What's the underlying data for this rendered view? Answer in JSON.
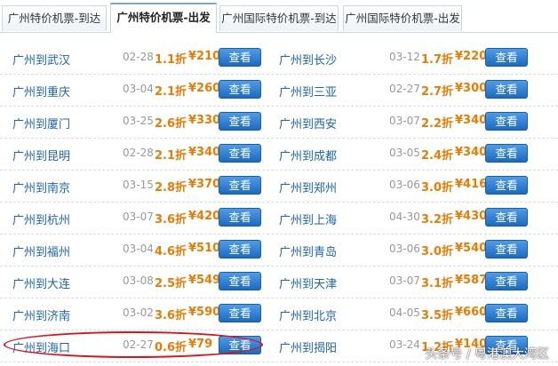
{
  "tabs": [
    {
      "label": "广州特价机票-到达",
      "active": false
    },
    {
      "label": "广州特价机票-出发",
      "active": true
    },
    {
      "label": "广州国际特价机票-到达",
      "active": false
    },
    {
      "label": "广州国际特价机票-出发",
      "active": false
    }
  ],
  "button_label": "查看",
  "rows": [
    {
      "left": {
        "route": "广州到武汉",
        "date": "02-28",
        "discount": "1.1折",
        "price": "¥210"
      },
      "right": {
        "route": "广州到长沙",
        "date": "03-12",
        "discount": "1.7折",
        "price": "¥220"
      }
    },
    {
      "left": {
        "route": "广州到重庆",
        "date": "03-04",
        "discount": "2.1折",
        "price": "¥260"
      },
      "right": {
        "route": "广州到三亚",
        "date": "02-27",
        "discount": "2.7折",
        "price": "¥300"
      }
    },
    {
      "left": {
        "route": "广州到厦门",
        "date": "03-25",
        "discount": "2.6折",
        "price": "¥330"
      },
      "right": {
        "route": "广州到西安",
        "date": "03-07",
        "discount": "2.2折",
        "price": "¥340"
      }
    },
    {
      "left": {
        "route": "广州到昆明",
        "date": "02-28",
        "discount": "2.1折",
        "price": "¥340"
      },
      "right": {
        "route": "广州到成都",
        "date": "03-05",
        "discount": "2.4折",
        "price": "¥340"
      }
    },
    {
      "left": {
        "route": "广州到南京",
        "date": "03-15",
        "discount": "2.8折",
        "price": "¥370"
      },
      "right": {
        "route": "广州到郑州",
        "date": "03-06",
        "discount": "3.0折",
        "price": "¥416"
      }
    },
    {
      "left": {
        "route": "广州到杭州",
        "date": "03-07",
        "discount": "3.6折",
        "price": "¥420"
      },
      "right": {
        "route": "广州到上海",
        "date": "04-30",
        "discount": "3.2折",
        "price": "¥430"
      }
    },
    {
      "left": {
        "route": "广州到福州",
        "date": "03-04",
        "discount": "4.6折",
        "price": "¥510"
      },
      "right": {
        "route": "广州到青岛",
        "date": "03-06",
        "discount": "3.0折",
        "price": "¥540"
      }
    },
    {
      "left": {
        "route": "广州到大连",
        "date": "03-08",
        "discount": "2.5折",
        "price": "¥549"
      },
      "right": {
        "route": "广州到天津",
        "date": "03-07",
        "discount": "3.1折",
        "price": "¥587"
      }
    },
    {
      "left": {
        "route": "广州到济南",
        "date": "03-02",
        "discount": "3.6折",
        "price": "¥590"
      },
      "right": {
        "route": "广州到北京",
        "date": "04-05",
        "discount": "3.5折",
        "price": "¥660"
      }
    },
    {
      "left": {
        "route": "广州到海口",
        "date": "02-27",
        "discount": "0.6折",
        "price": "¥79"
      },
      "right": {
        "route": "广州到揭阳",
        "date": "03-24",
        "discount": "1.2折",
        "price": "¥140"
      }
    }
  ],
  "watermark": "头条号 / 粤港澳大湾区",
  "colors": {
    "route_link": "#1a64b5",
    "discount_price": "#ee7a00",
    "button": "#1c6bc0",
    "highlight_circle": "#d9141b"
  }
}
